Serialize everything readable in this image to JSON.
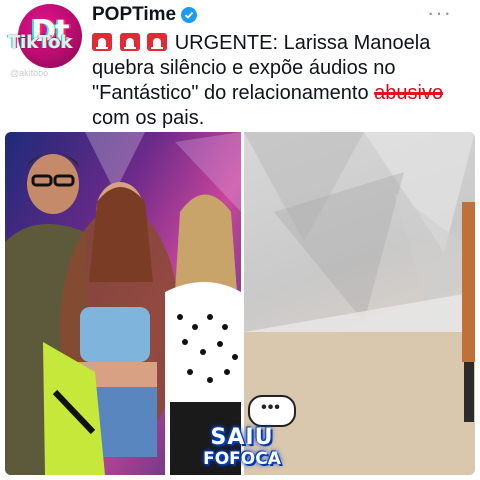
{
  "app": {
    "watermark_logo": "TikTok",
    "watermark_user": "@akitooo"
  },
  "post": {
    "avatar_text": "Dt",
    "author": "POPTime",
    "verified": true,
    "more_label": "···",
    "text_main": "URGENTE: Larissa Manoela quebra silêncio e expõe áudios no \"Fantástico\" do relacionamento ",
    "text_struck": "abusivo",
    "text_end": " com os pais.",
    "siren_icons": [
      "siren-icon",
      "siren-icon",
      "siren-icon"
    ]
  },
  "badge": {
    "line1": "SAIU",
    "line2": "FOFOCA",
    "bubble_dots": "•••"
  },
  "colors": {
    "verified": "#1d9bf0",
    "strike": "#e0141e",
    "avatar": "#d4157f",
    "badge_glow": "#0a4fd6"
  }
}
